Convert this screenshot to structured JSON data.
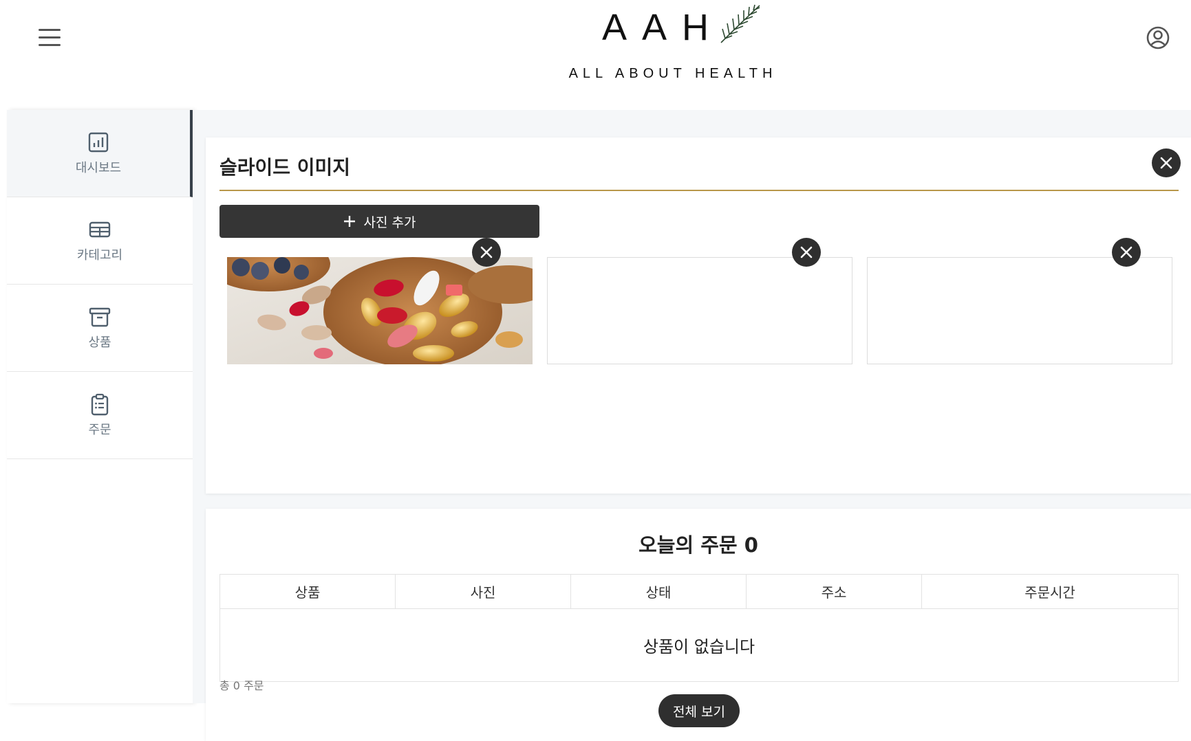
{
  "header": {
    "logo_main": "AAH",
    "logo_sub": "ALL ABOUT HEALTH"
  },
  "sidebar": {
    "items": [
      {
        "label": "대시보드",
        "icon": "chart-icon",
        "active": true
      },
      {
        "label": "카테고리",
        "icon": "table-icon",
        "active": false
      },
      {
        "label": "상품",
        "icon": "archive-box-icon",
        "active": false
      },
      {
        "label": "주문",
        "icon": "clipboard-list-icon",
        "active": false
      }
    ]
  },
  "slides": {
    "title": "슬라이드 이미지",
    "add_label": "사진 추가",
    "slots": [
      {
        "has_image": true,
        "image": "vitamin-pills-photo"
      },
      {
        "has_image": false
      },
      {
        "has_image": false
      }
    ]
  },
  "orders": {
    "title": "오늘의 주문 0",
    "columns": [
      "상품",
      "사진",
      "상태",
      "주소",
      "주문시간"
    ],
    "empty_message": "상품이 없습니다",
    "total_text": "총 0 주문",
    "view_all_label": "전체 보기"
  },
  "colors": {
    "accent_line": "#b8974a",
    "dark_button": "#353535",
    "sidebar_active_border": "#37404a"
  }
}
